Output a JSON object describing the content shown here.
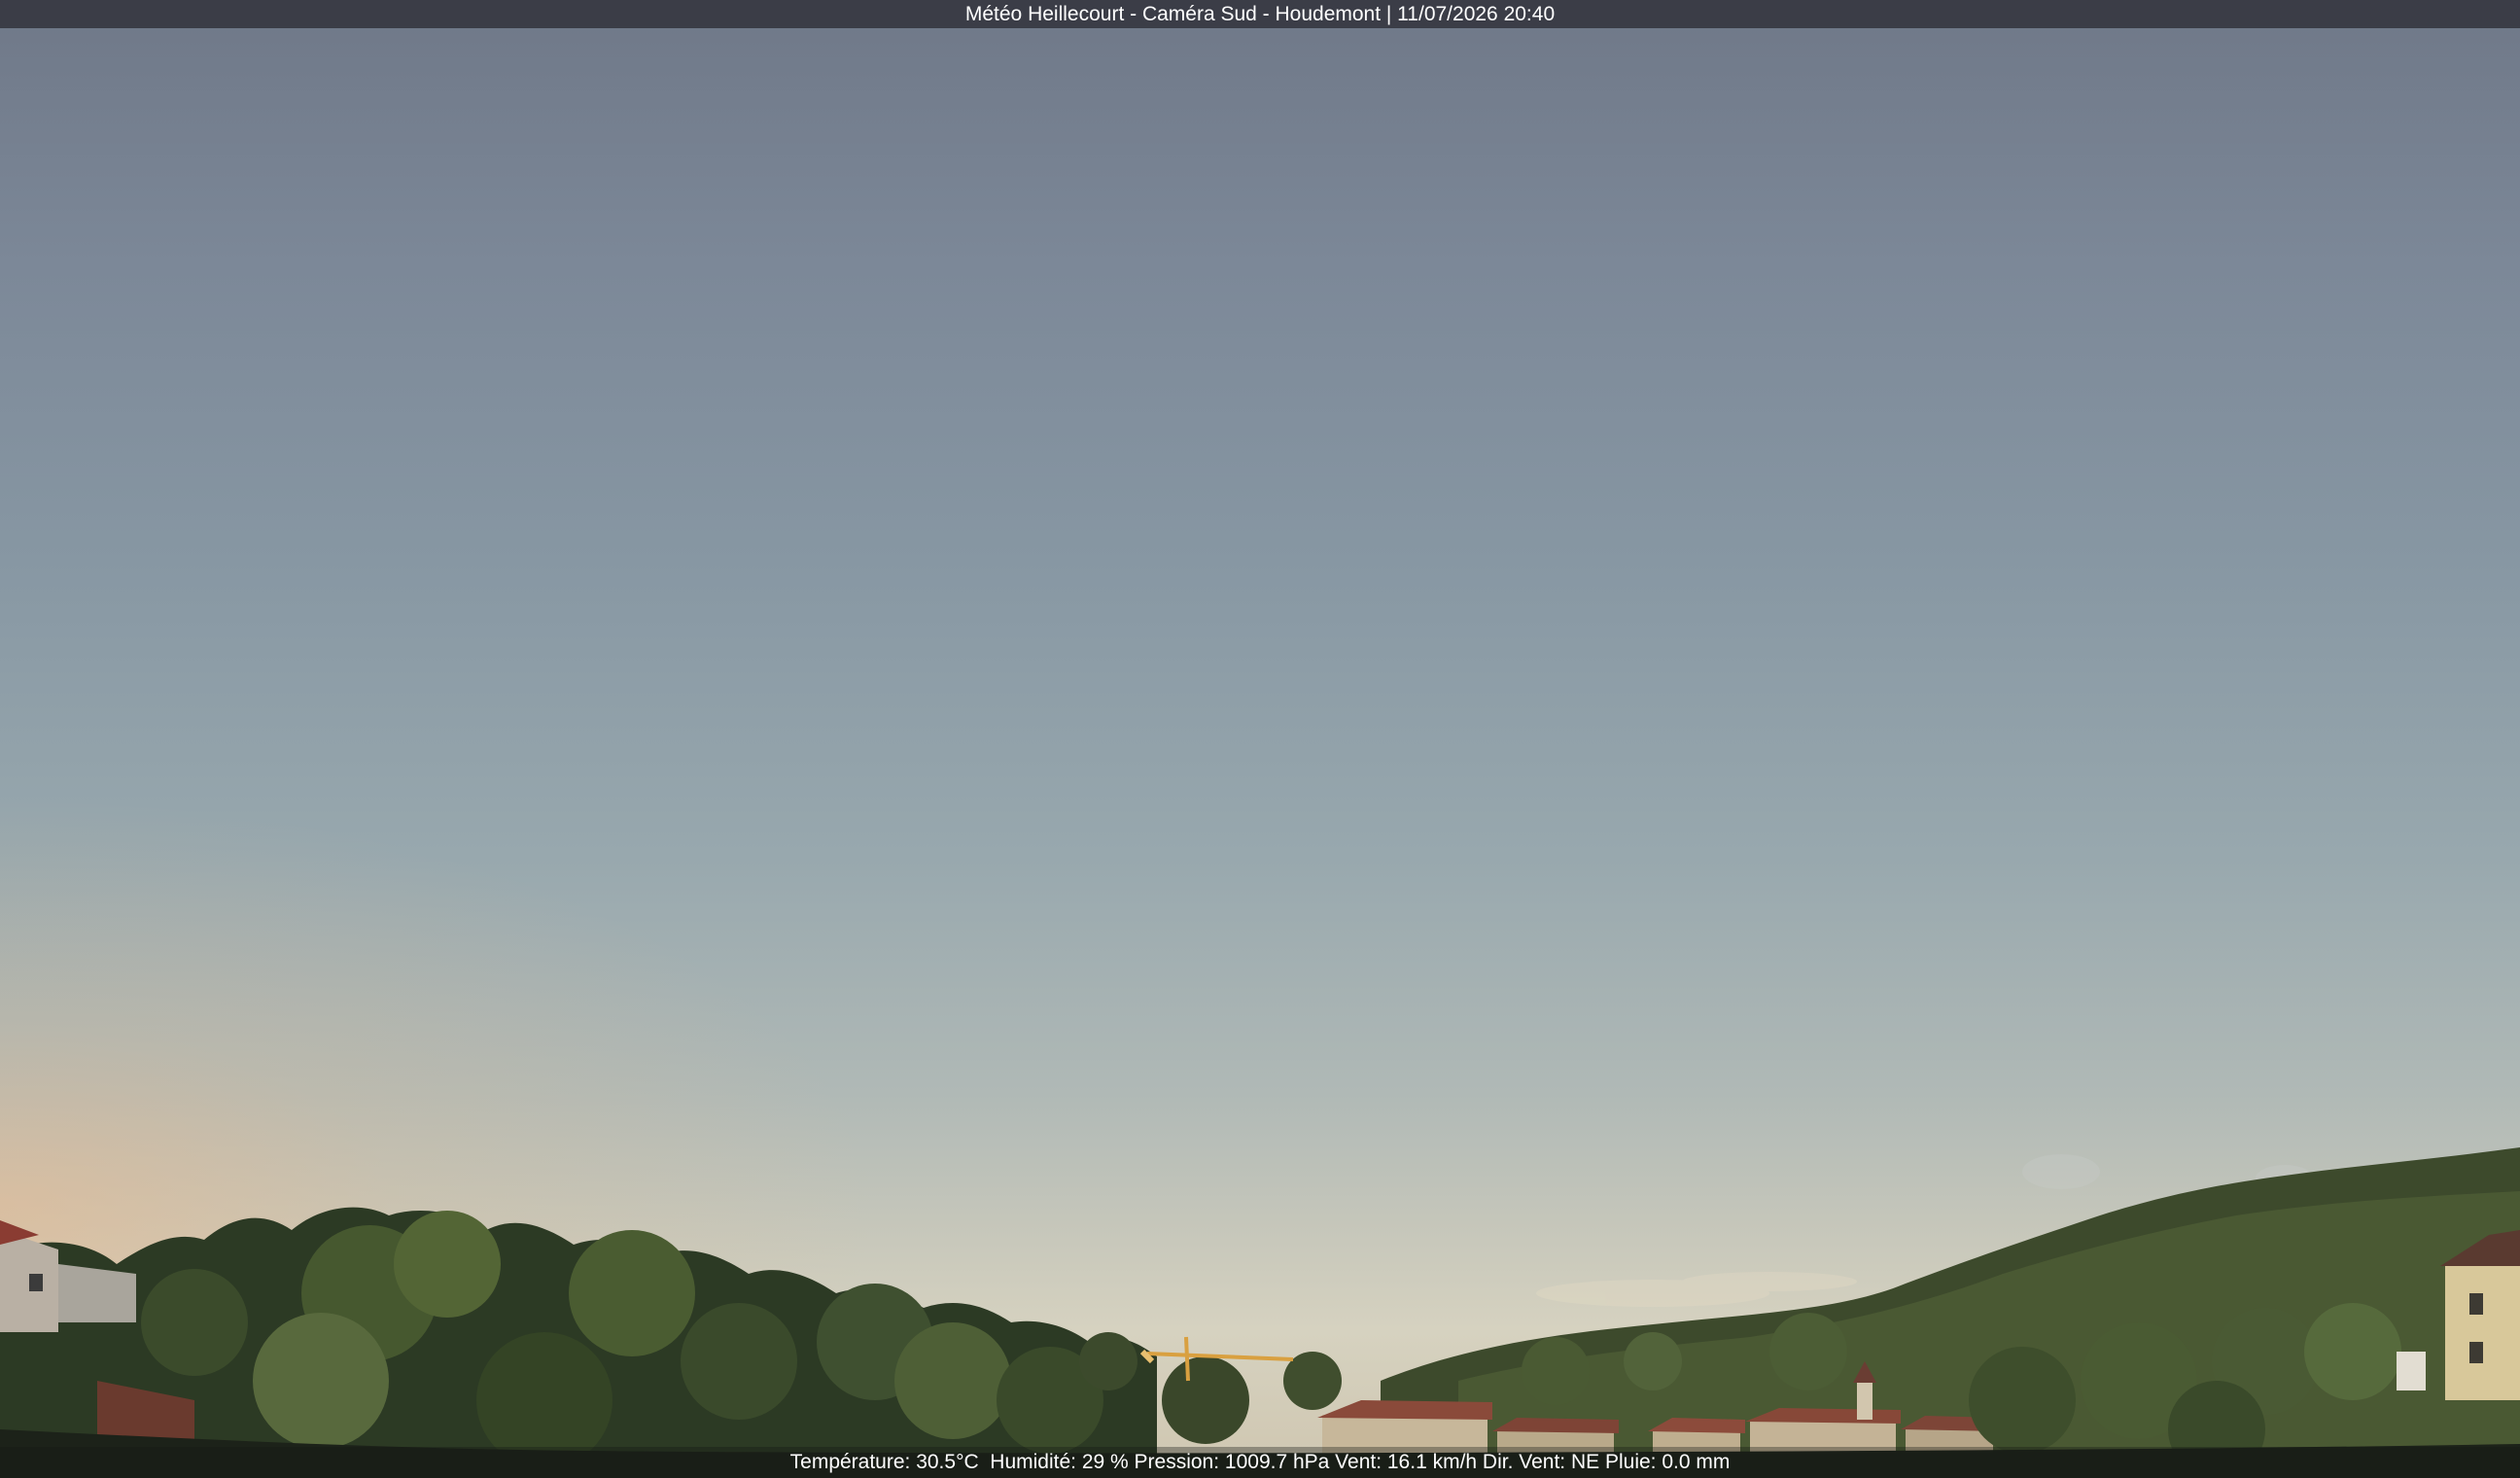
{
  "overlay": {
    "title": "Météo Heillecourt - Caméra Sud - Houdemont | 11/07/2026 20:40",
    "weather_line": "Température: 30.5°C  Humidité: 29 % Pression: 1009.7 hPa Vent: 16.1 km/h Dir. Vent: NE Pluie: 0.0 mm"
  },
  "scene": {
    "sky_top": "#6f7888",
    "sky_bottom": "#d6d2c0",
    "foliage_dark": "#2a3522",
    "foliage_mid": "#3e4f30",
    "foliage_light": "#5f6f40",
    "roof_red": "#8a4a3a",
    "wall_cream": "#c9b48c",
    "crane_orange": "#d9a040"
  }
}
